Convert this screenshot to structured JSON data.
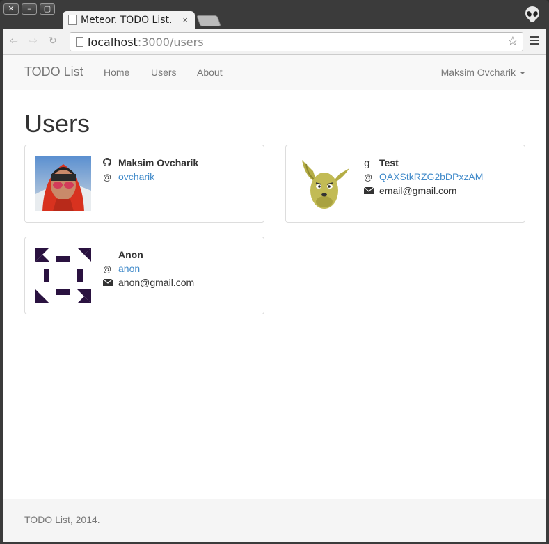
{
  "browser": {
    "tab_title": "Meteor. TODO List.",
    "tab_close": "×",
    "url_host": "localhost",
    "url_rest": ":3000/users"
  },
  "navbar": {
    "brand": "TODO List",
    "links": [
      "Home",
      "Users",
      "About"
    ],
    "user": "Maksim Ovcharik"
  },
  "page_title": "Users",
  "users": [
    {
      "name": "Maksim Ovcharik",
      "service_icon": "github-icon",
      "username": "ovcharik",
      "email": ""
    },
    {
      "name": "Test",
      "service_icon": "google-icon",
      "username": "QAXStkRZG2bDPxzAM",
      "email": "email@gmail.com"
    },
    {
      "name": "Anon",
      "service_icon": "",
      "username": "anon",
      "email": "anon@gmail.com"
    }
  ],
  "footer": "TODO List, 2014."
}
